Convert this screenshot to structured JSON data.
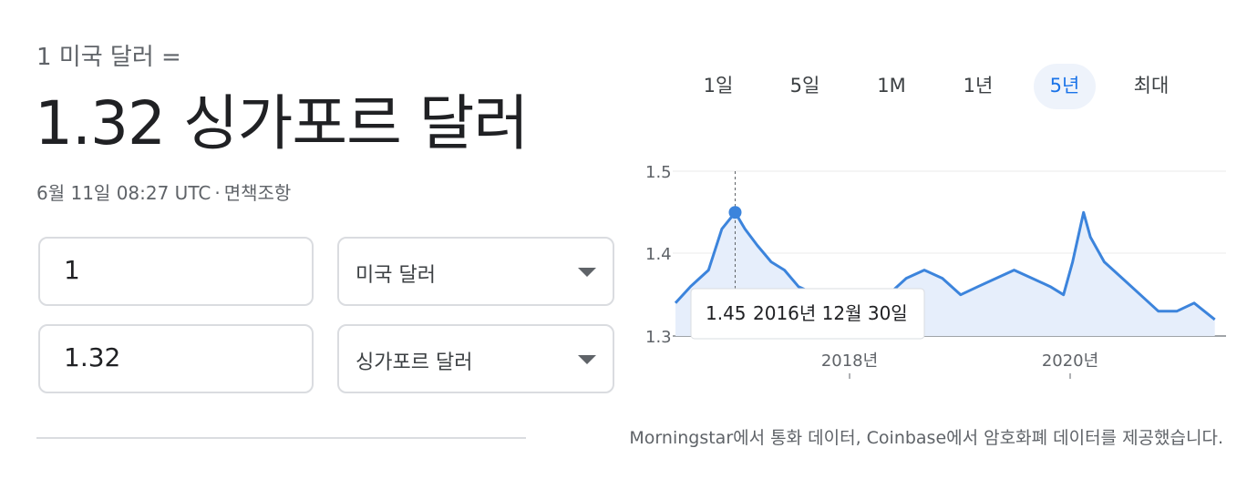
{
  "converter": {
    "base_line": "1 미국 달러 =",
    "result_line": "1.32 싱가포르 달러",
    "timestamp": "6월 11일 08:27 UTC",
    "separator": "·",
    "disclaimer": "면책조항",
    "from_amount": "1",
    "from_currency": "미국 달러",
    "to_amount": "1.32",
    "to_currency": "싱가포르 달러"
  },
  "range_tabs": [
    {
      "label": "1일",
      "active": false
    },
    {
      "label": "5일",
      "active": false
    },
    {
      "label": "1M",
      "active": false
    },
    {
      "label": "1년",
      "active": false
    },
    {
      "label": "5년",
      "active": true
    },
    {
      "label": "최대",
      "active": false
    }
  ],
  "tooltip": {
    "value": "1.45",
    "date": "2016년 12월 30일"
  },
  "credit": "Morningstar에서 통화 데이터, Coinbase에서 암호화폐 데이터를 제공했습니다.",
  "colors": {
    "accent": "#1a73e8",
    "line": "#3c84dc",
    "area": "#e6eefb",
    "text_muted": "#5f6368",
    "border": "#dadce0"
  },
  "chart_data": {
    "type": "area",
    "title": "",
    "xlabel": "",
    "ylabel": "",
    "y_ticks": [
      "1.5",
      "1.4",
      "1.3"
    ],
    "x_ticks": [
      "2018년",
      "2020년"
    ],
    "ylim": [
      1.3,
      1.5
    ],
    "grid": true,
    "highlight": {
      "date": "2016-12-30",
      "value": 1.45
    },
    "series": [
      {
        "x": [
          "2016-06-11",
          "2016-08-01",
          "2016-10-01",
          "2016-11-15",
          "2016-12-30",
          "2017-02-01",
          "2017-03-15",
          "2017-05-01",
          "2017-06-15",
          "2017-08-01",
          "2017-10-01",
          "2017-12-01",
          "2018-02-01",
          "2018-04-01",
          "2018-06-01",
          "2018-08-01",
          "2018-10-01",
          "2018-12-01",
          "2019-02-01",
          "2019-04-01",
          "2019-06-01",
          "2019-08-01",
          "2019-10-01",
          "2019-12-01",
          "2020-01-15",
          "2020-02-15",
          "2020-03-23",
          "2020-04-15",
          "2020-06-01",
          "2020-08-01",
          "2020-10-01",
          "2020-12-01",
          "2021-02-01",
          "2021-04-01",
          "2021-06-10"
        ],
        "y": [
          1.34,
          1.36,
          1.38,
          1.43,
          1.45,
          1.43,
          1.41,
          1.39,
          1.38,
          1.36,
          1.35,
          1.34,
          1.32,
          1.33,
          1.35,
          1.37,
          1.38,
          1.37,
          1.35,
          1.36,
          1.37,
          1.38,
          1.37,
          1.36,
          1.35,
          1.39,
          1.45,
          1.42,
          1.39,
          1.37,
          1.35,
          1.33,
          1.33,
          1.34,
          1.32
        ]
      }
    ]
  }
}
